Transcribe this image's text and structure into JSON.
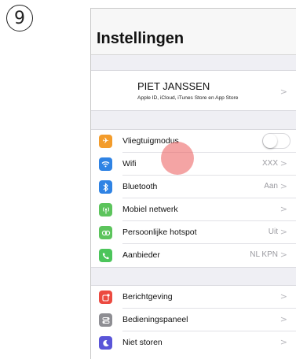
{
  "step_number": "9",
  "header": {
    "title": "Instellingen"
  },
  "profile": {
    "name": "PIET JANSSEN",
    "subtitle": "Apple ID, iCloud, iTunes Store en App Store"
  },
  "connectivity": [
    {
      "label": "Vliegtuigmodus",
      "icon": "airplane-icon",
      "color": "#f39c2b",
      "value": "",
      "toggle": true,
      "toggle_on": false
    },
    {
      "label": "Wifi",
      "icon": "wifi-icon",
      "color": "#2f83e4",
      "value": "XXX"
    },
    {
      "label": "Bluetooth",
      "icon": "bluetooth-icon",
      "color": "#2f83e4",
      "value": "Aan"
    },
    {
      "label": "Mobiel netwerk",
      "icon": "antenna-icon",
      "color": "#5cc45c",
      "value": ""
    },
    {
      "label": "Persoonlijke hotspot",
      "icon": "hotspot-icon",
      "color": "#5cc45c",
      "value": "Uit"
    },
    {
      "label": "Aanbieder",
      "icon": "phone-icon",
      "color": "#4cc55b",
      "value": "NL KPN"
    }
  ],
  "system": [
    {
      "label": "Berichtgeving",
      "icon": "notifications-icon",
      "color": "#ec4a40",
      "value": ""
    },
    {
      "label": "Bedieningspaneel",
      "icon": "control-center-icon",
      "color": "#8e8e93",
      "value": ""
    },
    {
      "label": "Niet storen",
      "icon": "moon-icon",
      "color": "#5a55d8",
      "value": ""
    }
  ],
  "chevron": ">"
}
